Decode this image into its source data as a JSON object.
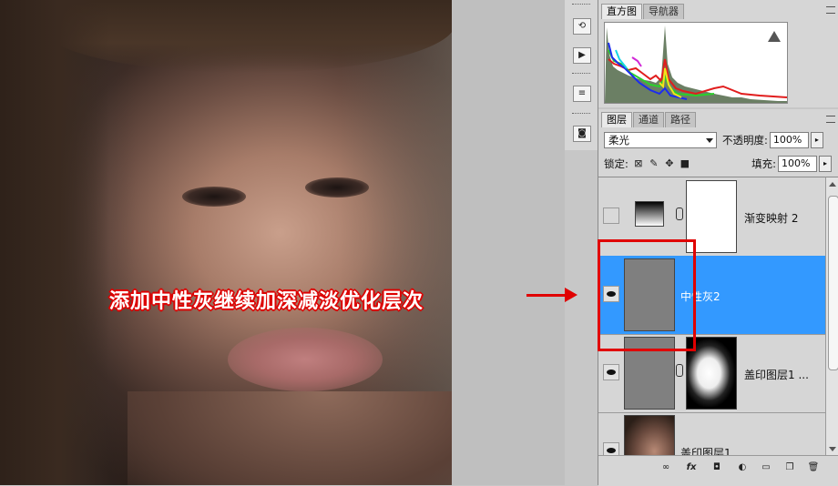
{
  "callout": {
    "text": "添加中性灰继续加深减淡优化层次"
  },
  "histogram_panel": {
    "tabs": [
      {
        "label": "直方图",
        "active": true
      },
      {
        "label": "导航器",
        "active": false
      }
    ],
    "warning_icon": "warning-triangle-icon"
  },
  "layers_panel": {
    "tabs": [
      {
        "label": "图层",
        "active": true
      },
      {
        "label": "通道",
        "active": false
      },
      {
        "label": "路径",
        "active": false
      }
    ],
    "blend_mode": "柔光",
    "opacity_label": "不透明度:",
    "opacity_value": "100%",
    "lock_label": "锁定:",
    "fill_label": "填充:",
    "fill_value": "100%",
    "layers": [
      {
        "name": "渐变映射 2",
        "visible": false,
        "selected": false
      },
      {
        "name": "中性灰2",
        "visible": true,
        "selected": true
      },
      {
        "name": "盖印图层1 ...",
        "visible": true,
        "selected": false
      },
      {
        "name": "盖印图层1",
        "visible": true,
        "selected": false
      }
    ],
    "bottom_tools": [
      "link-icon",
      "fx-icon",
      "mask-icon",
      "adjustment-icon",
      "folder-icon",
      "new-layer-icon",
      "trash-icon"
    ]
  },
  "colors": {
    "selection_blue": "#3399ff",
    "annotation_red": "#e00000"
  }
}
